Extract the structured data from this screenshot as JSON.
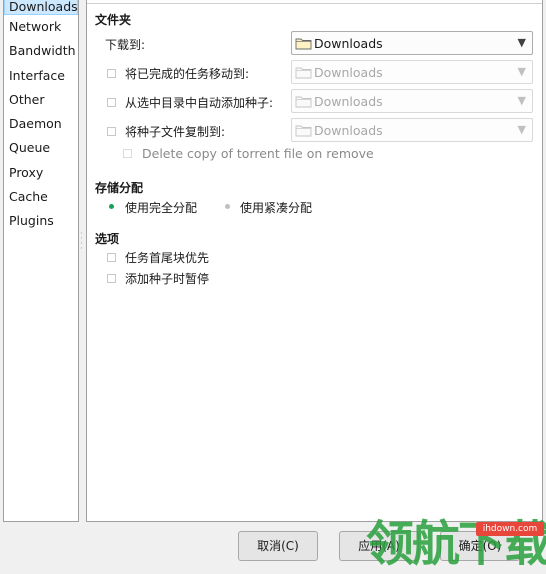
{
  "sidebar": {
    "items": [
      {
        "label": "Downloads",
        "selected": true
      },
      {
        "label": "Network"
      },
      {
        "label": "Bandwidth"
      },
      {
        "label": "Interface"
      },
      {
        "label": "Other"
      },
      {
        "label": "Daemon"
      },
      {
        "label": "Queue"
      },
      {
        "label": "Proxy"
      },
      {
        "label": "Cache"
      },
      {
        "label": "Plugins"
      }
    ]
  },
  "folders": {
    "title": "文件夹",
    "download_to_label": "下载到:",
    "download_to_value": "Downloads",
    "move_completed_label": "将已完成的任务移动到:",
    "move_completed_value": "Downloads",
    "autoadd_label": "从选中目录中自动添加种子:",
    "autoadd_value": "Downloads",
    "copy_torrent_label": "将种子文件复制到:",
    "copy_torrent_value": "Downloads",
    "delete_copy_label": "Delete copy of torrent file on remove"
  },
  "allocation": {
    "title": "存储分配",
    "full_label": "使用完全分配",
    "compact_label": "使用紧凑分配"
  },
  "options": {
    "title": "选项",
    "prioritize_label": "任务首尾块优先",
    "add_paused_label": "添加种子时暂停"
  },
  "buttons": {
    "cancel": "取消(C)",
    "apply": "应用(A)",
    "ok": "确定(O)"
  },
  "watermark": {
    "text": "领航下载",
    "badge": "ihdown.com"
  },
  "colors": {
    "accent": "#1c9e5c",
    "selection": "#cce8ff"
  }
}
